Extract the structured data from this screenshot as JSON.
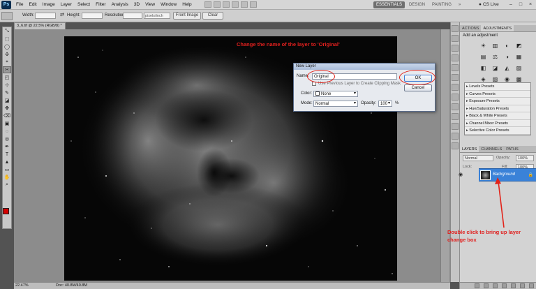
{
  "menubar": {
    "logo": "Ps",
    "items": [
      "File",
      "Edit",
      "Image",
      "Layer",
      "Select",
      "Filter",
      "Analysis",
      "3D",
      "View",
      "Window",
      "Help"
    ],
    "workspaces": [
      "ESSENTIALS",
      "DESIGN",
      "PAINTING",
      "»"
    ],
    "cs_live": "CS Live",
    "window_controls": [
      "–",
      "□",
      "×"
    ]
  },
  "options": {
    "width_label": "Width:",
    "height_label": "Height:",
    "resolution_label": "Resolution:",
    "resolution_unit": "pixels/inch",
    "front_image": "Front Image",
    "clear": "Clear"
  },
  "document": {
    "tab_title": "3_6.tif @ 22.5% (RGB/8) *",
    "zoom": "22.47%",
    "doc_info": "Doc: 40.8M/40.8M"
  },
  "annotations": {
    "top": "Change the name of the layer to 'Original'",
    "bottom": "Double click to bring up layer change box"
  },
  "dialog": {
    "title": "New Layer",
    "name_label": "Name:",
    "name_value": "Original",
    "clip_label": "Use Previous Layer to Create Clipping Mask",
    "color_label": "Color:",
    "color_value": "None",
    "mode_label": "Mode:",
    "mode_value": "Normal",
    "opacity_label": "Opacity:",
    "opacity_value": "100",
    "opacity_unit": "%",
    "ok": "OK",
    "cancel": "Cancel"
  },
  "adjustments": {
    "tabs": [
      "ACTIONS",
      "ADJUSTMENTS"
    ],
    "title": "Add an adjustment",
    "icons": [
      "☀",
      "▥",
      "◐",
      "◩",
      "▤",
      "⚖",
      "◑",
      "▦",
      "◧",
      "◪",
      "◭",
      "▨",
      "◈",
      "▧",
      "◉",
      "▩"
    ],
    "presets": [
      "Levels Presets",
      "Curves Presets",
      "Exposure Presets",
      "Hue/Saturation Presets",
      "Black & White Presets",
      "Channel Mixer Presets",
      "Selective Color Presets"
    ]
  },
  "layers": {
    "tabs": [
      "LAYERS",
      "CHANNELS",
      "PATHS"
    ],
    "blend_mode": "Normal",
    "opacity_label": "Opacity:",
    "opacity_value": "100%",
    "lock_label": "Lock:",
    "fill_label": "Fill:",
    "fill_value": "100%",
    "layer_name": "Background"
  },
  "tools": [
    "⤡",
    "⬚",
    "◯",
    "✣",
    "⌖",
    "✂",
    "◰",
    "⊹",
    "✎",
    "◪",
    "✤",
    "⌫",
    "▣",
    "◌",
    "◎",
    "✒",
    "T",
    "▲",
    "▭",
    "✋",
    "⌕"
  ],
  "colors": {
    "annotation": "#e0201e",
    "layer_selected": "#3a82d8",
    "foreground_swatch": "#d40000"
  }
}
